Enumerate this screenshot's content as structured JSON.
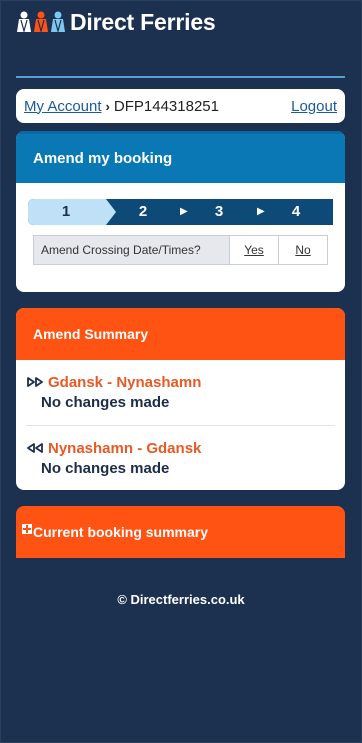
{
  "brand": {
    "name": "Direct Ferries",
    "icon_colors": [
      "#ffffff",
      "#ff5313",
      "#7ec8f0"
    ]
  },
  "account_bar": {
    "my_account_label": "My Account",
    "separator": "›",
    "booking_ref": "DFP144318251",
    "logout_label": "Logout"
  },
  "amend": {
    "title": "Amend my booking",
    "steps": [
      "1",
      "2",
      "3",
      "4"
    ],
    "active_step": 1,
    "question": "Amend Crossing Date/Times?",
    "yes_label": "Yes",
    "no_label": "No"
  },
  "summary": {
    "title": "Amend Summary",
    "routes": [
      {
        "direction": "outbound",
        "icon": "double-chevron-right-icon",
        "name": "Gdansk - Nynashamn",
        "status": "No changes made"
      },
      {
        "direction": "return",
        "icon": "double-chevron-left-icon",
        "name": "Nynashamn - Gdansk",
        "status": "No changes made"
      }
    ]
  },
  "current_booking": {
    "title": "Current booking summary"
  },
  "footer": {
    "text": "© Directferries.co.uk"
  },
  "colors": {
    "background": "#1c3050",
    "header_blue": "#0a78b5",
    "accent_orange": "#ff5313",
    "step_active": "#bfe1f7",
    "step_inactive": "#0e4a78"
  }
}
